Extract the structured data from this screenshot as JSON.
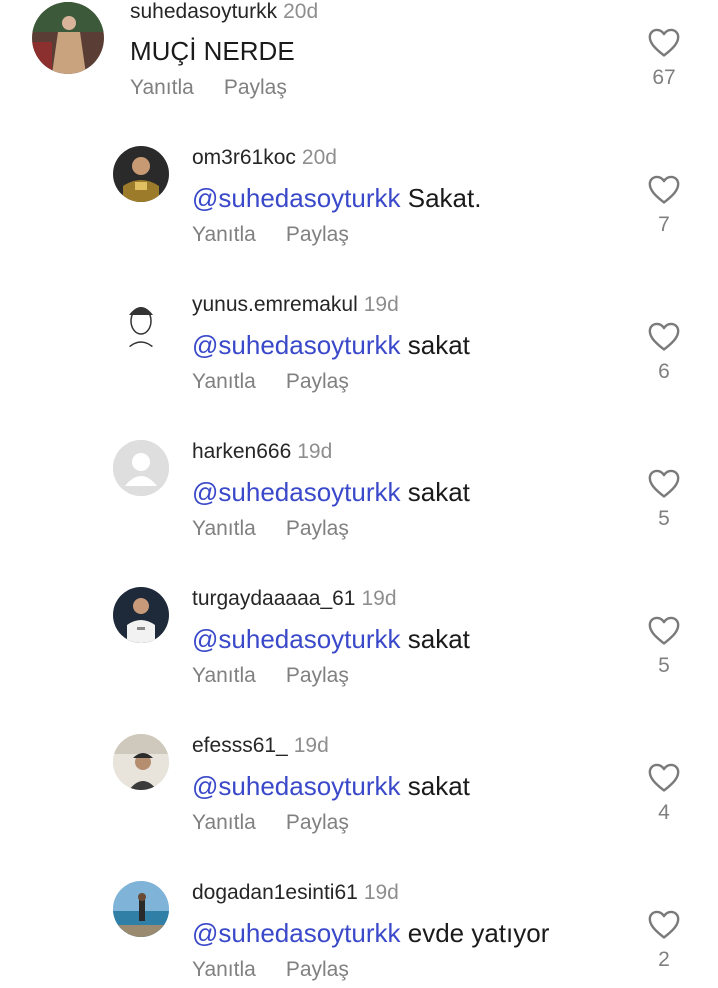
{
  "labels": {
    "reply": "Yanıtla",
    "share": "Paylaş"
  },
  "colors": {
    "mention": "#3a49c9",
    "muted": "#808080"
  },
  "comments": [
    {
      "user": "suhedasoyturkk",
      "time": "20d",
      "mention": "",
      "text": "MUÇİ NERDE",
      "likes": "67",
      "icon": "heart-outline-icon"
    },
    {
      "user": "om3r61koc",
      "time": "20d",
      "mention": "@suhedasoyturkk",
      "text": "Sakat.",
      "likes": "7",
      "icon": "heart-outline-icon"
    },
    {
      "user": "yunus.emremakul",
      "time": "19d",
      "mention": "@suhedasoyturkk",
      "text": "sakat",
      "likes": "6",
      "icon": "heart-outline-icon"
    },
    {
      "user": "harken666",
      "time": "19d",
      "mention": "@suhedasoyturkk",
      "text": "sakat",
      "likes": "5",
      "icon": "heart-outline-icon"
    },
    {
      "user": "turgaydaaaaa_61",
      "time": "19d",
      "mention": "@suhedasoyturkk",
      "text": "sakat",
      "likes": "5",
      "icon": "heart-outline-icon"
    },
    {
      "user": "efesss61_",
      "time": "19d",
      "mention": "@suhedasoyturkk",
      "text": "sakat",
      "likes": "4",
      "icon": "heart-outline-icon"
    },
    {
      "user": "dogadan1esinti61",
      "time": "19d",
      "mention": "@suhedasoyturkk",
      "text": "evde yatıyor",
      "likes": "2",
      "icon": "heart-outline-icon"
    }
  ]
}
